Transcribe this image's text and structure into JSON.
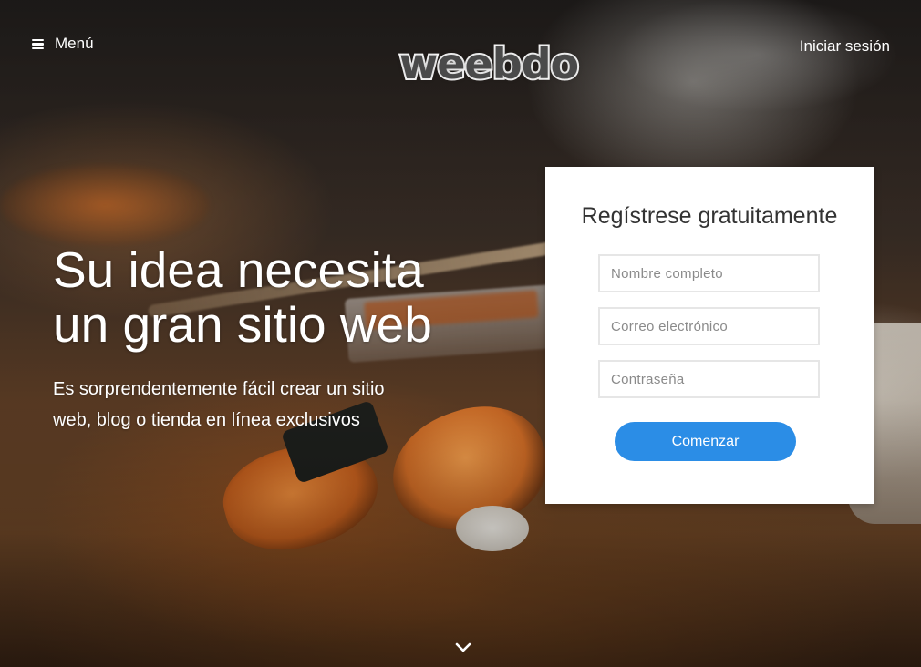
{
  "nav": {
    "menu_label": "Menú",
    "menu_icon": "hamburger-icon",
    "logo_text": "weebdo",
    "login_label": "Iniciar sesión"
  },
  "hero": {
    "headline_line1": "Su idea necesita",
    "headline_line2": "un gran sitio web",
    "subtext_line1": "Es sorprendentemente fácil crear un sitio",
    "subtext_line2": "web, blog o tienda en línea exclusivos",
    "scroll_icon": "chevron-down-icon"
  },
  "signup": {
    "title": "Regístrese gratuitamente",
    "name_placeholder": "Nombre completo",
    "email_placeholder": "Correo electrónico",
    "password_placeholder": "Contraseña",
    "name_value": "",
    "email_value": "",
    "password_value": "",
    "submit_label": "Comenzar"
  },
  "colors": {
    "accent": "#2b8de6",
    "card_bg": "#ffffff",
    "title_text": "#333333"
  }
}
